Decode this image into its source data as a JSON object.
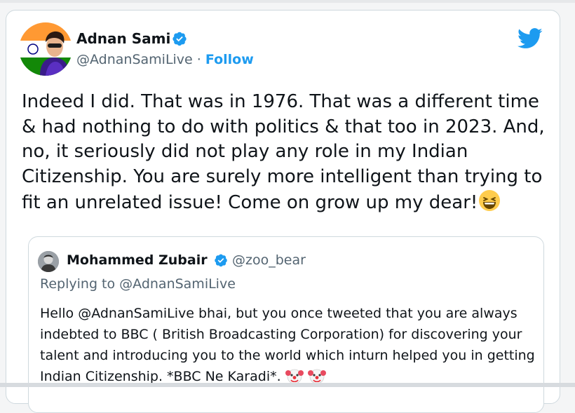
{
  "tweet": {
    "author_name": "Adnan Sami",
    "author_handle": "@AdnanSamiLive",
    "separator": " · ",
    "follow_label": "Follow",
    "text": "Indeed I did. That was in 1976. That was a different time & had nothing to do with politics & that too in 2023. And, no, it seriously did not play any role in my Indian Citizenship. You are surely more intelligent than trying to fit an unrelated issue! Come on grow up my dear!",
    "text_emoji": "grinning-squinting-face-emoji"
  },
  "quoted_tweet": {
    "author_name": "Mohammed Zubair",
    "author_handle": "@zoo_bear",
    "replying_to": "Replying to @AdnanSamiLive",
    "text": "Hello @AdnanSamiLive bhai, but you once tweeted that you are always indebted to BBC ( British Broadcasting Corporation) for discovering your talent and introducing you to the world which inturn helped you in getting Indian Citizenship. *BBC Ne Karadi*.",
    "text_emojis": [
      "clown-face-emoji",
      "clown-face-emoji"
    ]
  },
  "icons": {
    "brand": "twitter-bird-icon",
    "verified": "verified-badge-icon"
  },
  "colors": {
    "twitter_blue": "#1d9bf0",
    "secondary_text": "#536471",
    "primary_text": "#0f1419",
    "border": "#cfd9de"
  }
}
